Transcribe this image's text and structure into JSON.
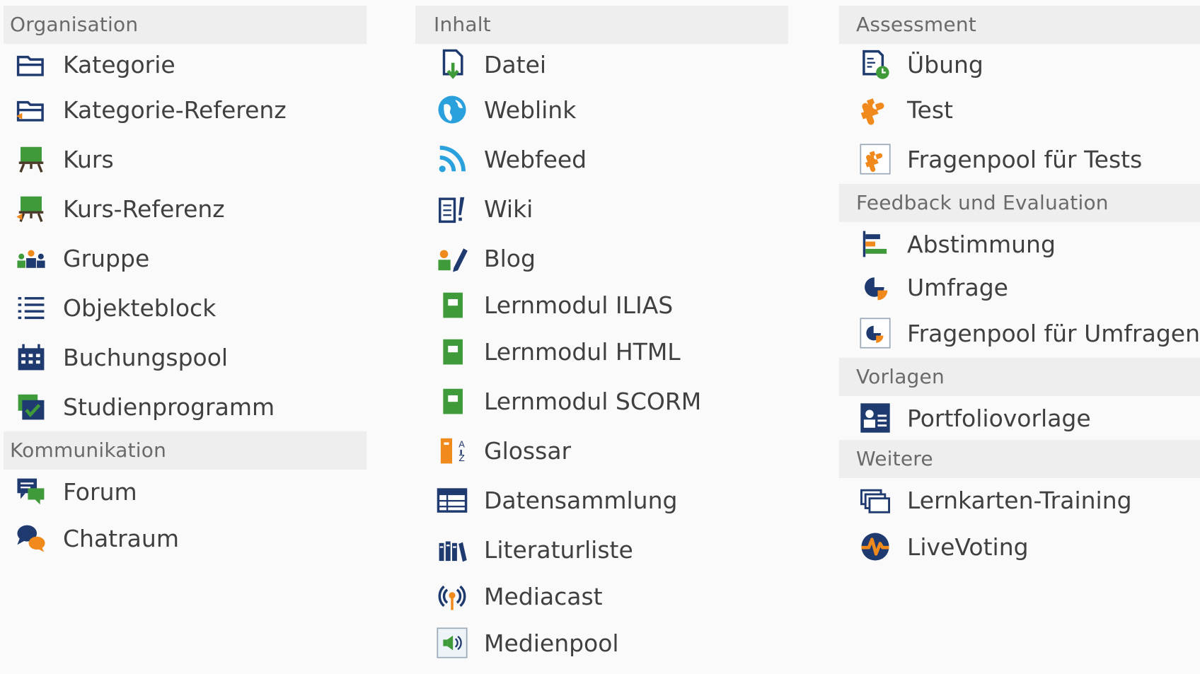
{
  "columns": [
    {
      "groups": [
        {
          "header": "Organisation",
          "items": [
            {
              "label": "Kategorie",
              "icon": "category-icon"
            },
            {
              "label": "Kategorie-Referenz",
              "icon": "category-reference-icon"
            },
            {
              "label": "Kurs",
              "icon": "course-icon"
            },
            {
              "label": "Kurs-Referenz",
              "icon": "course-reference-icon"
            },
            {
              "label": "Gruppe",
              "icon": "group-icon"
            },
            {
              "label": "Objekteblock",
              "icon": "item-group-icon"
            },
            {
              "label": "Buchungspool",
              "icon": "booking-pool-icon"
            },
            {
              "label": "Studienprogramm",
              "icon": "study-programme-icon"
            }
          ]
        },
        {
          "header": "Kommunikation",
          "items": [
            {
              "label": "Forum",
              "icon": "forum-icon"
            },
            {
              "label": "Chatraum",
              "icon": "chatroom-icon"
            }
          ]
        }
      ]
    },
    {
      "groups": [
        {
          "header": "Inhalt",
          "items": [
            {
              "label": "Datei",
              "icon": "file-icon"
            },
            {
              "label": "Weblink",
              "icon": "weblink-icon"
            },
            {
              "label": "Webfeed",
              "icon": "webfeed-icon"
            },
            {
              "label": "Wiki",
              "icon": "wiki-icon"
            },
            {
              "label": "Blog",
              "icon": "blog-icon"
            },
            {
              "label": "Lernmodul ILIAS",
              "icon": "learning-module-icon"
            },
            {
              "label": "Lernmodul HTML",
              "icon": "learning-module-icon"
            },
            {
              "label": "Lernmodul SCORM",
              "icon": "learning-module-icon"
            },
            {
              "label": "Glossar",
              "icon": "glossary-icon"
            },
            {
              "label": "Datensammlung",
              "icon": "data-collection-icon"
            },
            {
              "label": "Literaturliste",
              "icon": "bibliography-icon"
            },
            {
              "label": "Mediacast",
              "icon": "mediacast-icon"
            },
            {
              "label": "Medienpool",
              "icon": "media-pool-icon"
            }
          ]
        }
      ]
    },
    {
      "groups": [
        {
          "header": "Assessment",
          "items": [
            {
              "label": "Übung",
              "icon": "exercise-icon"
            },
            {
              "label": "Test",
              "icon": "test-icon"
            },
            {
              "label": "Fragenpool für Tests",
              "icon": "test-question-pool-icon"
            }
          ]
        },
        {
          "header": "Feedback und Evaluation",
          "items": [
            {
              "label": "Abstimmung",
              "icon": "poll-icon"
            },
            {
              "label": "Umfrage",
              "icon": "survey-icon"
            },
            {
              "label": "Fragenpool für Umfragen",
              "icon": "survey-question-pool-icon"
            }
          ]
        },
        {
          "header": "Vorlagen",
          "items": [
            {
              "label": "Portfoliovorlage",
              "icon": "portfolio-template-icon"
            }
          ]
        },
        {
          "header": "Weitere",
          "items": [
            {
              "label": "Lernkarten-Training",
              "icon": "flashcards-icon"
            },
            {
              "label": "LiveVoting",
              "icon": "livevoting-icon"
            }
          ]
        }
      ]
    }
  ],
  "colors": {
    "header_bg": "#eeeeee",
    "header_text": "#6a6a6a",
    "item_text": "#404040",
    "navy": "#1f3a6e",
    "green": "#3f9a3a",
    "orange": "#f08a1c",
    "blue": "#2aa0dc"
  }
}
